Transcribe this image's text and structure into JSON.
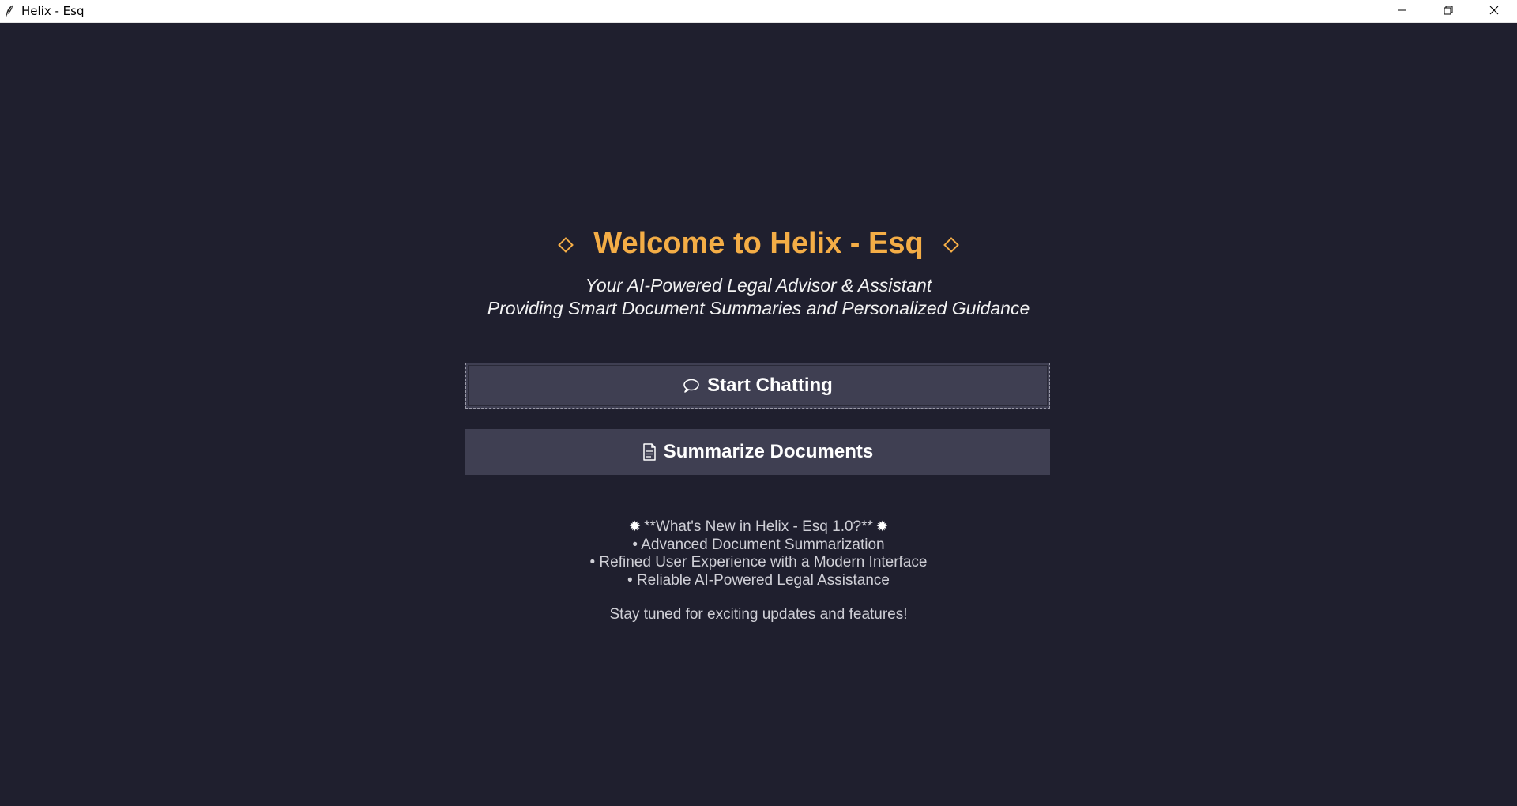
{
  "window": {
    "title": "Helix - Esq",
    "controls": [
      "minimize-icon",
      "restore-icon",
      "close-icon"
    ]
  },
  "header": {
    "welcome": "Welcome to Helix - Esq",
    "subtitle_line1": "Your AI-Powered Legal Advisor & Assistant",
    "subtitle_line2": "Providing Smart Document Summaries and Personalized Guidance"
  },
  "actions": {
    "start_chatting": "Start Chatting",
    "start_chatting_icon": "speech-bubble-icon",
    "summarize_documents": "Summarize Documents",
    "summarize_documents_icon": "document-icon"
  },
  "whats_new": {
    "heading": "**What's New in Helix - Esq 1.0?**",
    "items": [
      "• Advanced Document Summarization",
      "• Refined User Experience with a Modern Interface",
      "• Reliable AI-Powered Legal Assistance"
    ],
    "footer": "Stay tuned for exciting updates and features!"
  },
  "colors": {
    "background": "#1f1f2e",
    "accent": "#f4ad46",
    "button": "#3f3f52"
  }
}
